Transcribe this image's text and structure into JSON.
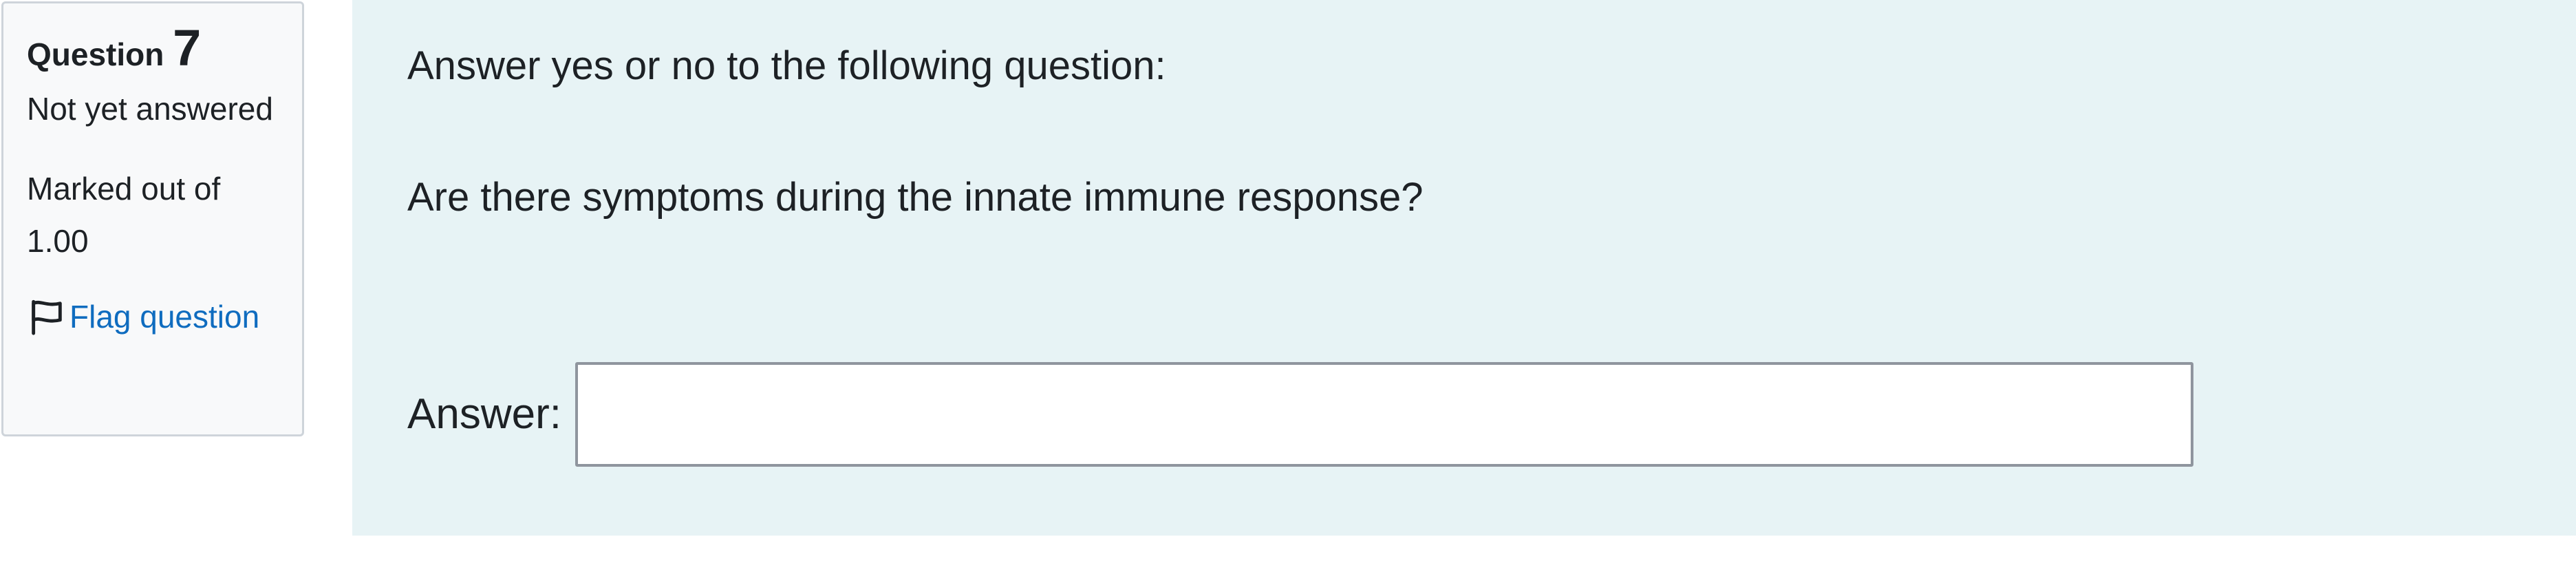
{
  "info": {
    "question_label": "Question",
    "question_number": "7",
    "state": "Not yet answered",
    "grade": "Marked out of 1.00",
    "flag_label": "Flag question"
  },
  "question": {
    "instruction": "Answer yes or no to the following question:",
    "text": "Are there symptoms during the innate immune response?",
    "answer_label": "Answer:",
    "answer_value": ""
  },
  "colors": {
    "info_background": "#f8f9fa",
    "info_border": "#ced4da",
    "content_background": "#e7f3f5",
    "link": "#0f6cbf",
    "input_border": "#8f959e"
  },
  "icons": {
    "flag": "flag-outline-icon"
  }
}
